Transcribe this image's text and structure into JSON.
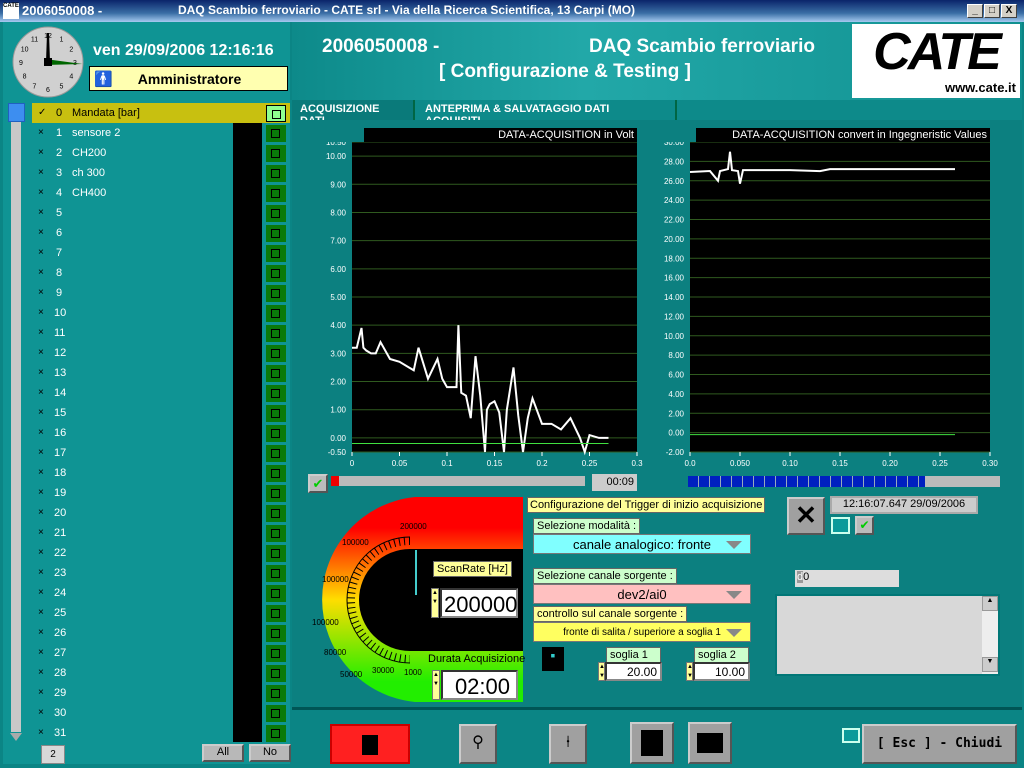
{
  "window": {
    "title_left": "2006050008 -",
    "title_right": "DAQ Scambio ferroviario - CATE srl  -  Via della Ricerca Scientifica, 13 Carpi (MO)",
    "min": "_",
    "max": "□",
    "close": "X"
  },
  "header": {
    "id": "2006050008 -",
    "name": "DAQ Scambio ferroviario",
    "subtitle": "[ Configurazione & Testing ]",
    "logo": "CATE",
    "logo_url": "www.cate.it"
  },
  "clock": {
    "datetime": "ven 29/09/2006 12:16:16",
    "user": "Amministratore",
    "hour_labels": [
      "12",
      "1",
      "2",
      "3",
      "4",
      "5",
      "6",
      "7",
      "8",
      "9",
      "10",
      "11"
    ]
  },
  "channels": [
    {
      "n": "0",
      "label": "Mandata  [bar]",
      "selected": true
    },
    {
      "n": "1",
      "label": "sensore 2"
    },
    {
      "n": "2",
      "label": "CH200"
    },
    {
      "n": "3",
      "label": "ch 300"
    },
    {
      "n": "4",
      "label": "CH400"
    },
    {
      "n": "5",
      "label": ""
    },
    {
      "n": "6",
      "label": ""
    },
    {
      "n": "7",
      "label": ""
    },
    {
      "n": "8",
      "label": ""
    },
    {
      "n": "9",
      "label": ""
    },
    {
      "n": "10",
      "label": ""
    },
    {
      "n": "11",
      "label": ""
    },
    {
      "n": "12",
      "label": ""
    },
    {
      "n": "13",
      "label": ""
    },
    {
      "n": "14",
      "label": ""
    },
    {
      "n": "15",
      "label": ""
    },
    {
      "n": "16",
      "label": ""
    },
    {
      "n": "17",
      "label": ""
    },
    {
      "n": "18",
      "label": ""
    },
    {
      "n": "19",
      "label": ""
    },
    {
      "n": "20",
      "label": ""
    },
    {
      "n": "21",
      "label": ""
    },
    {
      "n": "22",
      "label": ""
    },
    {
      "n": "23",
      "label": ""
    },
    {
      "n": "24",
      "label": ""
    },
    {
      "n": "25",
      "label": ""
    },
    {
      "n": "26",
      "label": ""
    },
    {
      "n": "27",
      "label": ""
    },
    {
      "n": "28",
      "label": ""
    },
    {
      "n": "29",
      "label": ""
    },
    {
      "n": "30",
      "label": ""
    },
    {
      "n": "31",
      "label": ""
    }
  ],
  "channel_list": {
    "index": "2",
    "all": "All",
    "no": "No",
    "checked_mark": "✓",
    "unchecked_mark": "×"
  },
  "tabs": [
    {
      "label": "ACQUISIZIONE DATI",
      "active": true
    },
    {
      "label": "ANTEPRIMA & SALVATAGGIO DATI ACQUISITI"
    }
  ],
  "chart_data": [
    {
      "type": "line",
      "title": "DATA-ACQUISITION in Volt",
      "xlim": [
        0,
        0.3
      ],
      "ylim": [
        -0.5,
        10.5
      ],
      "xticks": [
        "0",
        "0.05",
        "0.1",
        "0.15",
        "0.2",
        "0.25",
        "0.3"
      ],
      "xtick_values": [
        0,
        0.05,
        0.1,
        0.15,
        0.2,
        0.25,
        0.3
      ],
      "yticks": [
        "10.50",
        "10.00",
        "9.00",
        "8.00",
        "7.00",
        "6.00",
        "5.00",
        "4.00",
        "3.00",
        "2.00",
        "1.00",
        "0.00",
        "-0.50"
      ],
      "ytick_values": [
        10.5,
        10,
        9,
        8,
        7,
        6,
        5,
        4,
        3,
        2,
        1,
        0,
        -0.5
      ],
      "grid": true,
      "series": [
        {
          "color": "#ffffff",
          "x": [
            0,
            0.005,
            0.01,
            0.012,
            0.015,
            0.02,
            0.025,
            0.03,
            0.04,
            0.05,
            0.06,
            0.065,
            0.07,
            0.08,
            0.09,
            0.095,
            0.1,
            0.11,
            0.112,
            0.115,
            0.12,
            0.125,
            0.13,
            0.135,
            0.14,
            0.142,
            0.145,
            0.15,
            0.155,
            0.16,
            0.163,
            0.17,
            0.175,
            0.18,
            0.185,
            0.19,
            0.2,
            0.21,
            0.22,
            0.23,
            0.24,
            0.245,
            0.25,
            0.26,
            0.27
          ],
          "y": [
            3.2,
            3.2,
            3.9,
            3.2,
            3.1,
            3.0,
            3.0,
            3.4,
            2.8,
            2.7,
            2.5,
            2.4,
            3.2,
            2.1,
            2.8,
            2.1,
            1.8,
            1.8,
            4.0,
            1.6,
            1.5,
            0.7,
            2.9,
            1.5,
            -0.5,
            1.0,
            1.2,
            1.3,
            0.9,
            -0.5,
            1.0,
            2.5,
            0.8,
            -0.5,
            0.7,
            1.4,
            0.5,
            0.5,
            0.3,
            0.7,
            0.0,
            -0.5,
            0.1,
            0.0,
            0.0
          ]
        },
        {
          "color": "#40e040",
          "x": [
            0,
            0.27
          ],
          "y": [
            -0.2,
            -0.2
          ]
        }
      ]
    },
    {
      "type": "line",
      "title": "DATA-ACQUISITION convert in Ingegneristic Values",
      "xlim": [
        0,
        0.3
      ],
      "ylim": [
        -2,
        30
      ],
      "xticks": [
        "0.0",
        "0.050",
        "0.10",
        "0.15",
        "0.20",
        "0.25",
        "0.30"
      ],
      "xtick_values": [
        0,
        0.05,
        0.1,
        0.15,
        0.2,
        0.25,
        0.3
      ],
      "yticks": [
        "30.00",
        "28.00",
        "26.00",
        "24.00",
        "22.00",
        "20.00",
        "18.00",
        "16.00",
        "14.00",
        "12.00",
        "10.00",
        "8.00",
        "6.00",
        "4.00",
        "2.00",
        "0.00",
        "-2.00"
      ],
      "ytick_values": [
        30,
        28,
        26,
        24,
        22,
        20,
        18,
        16,
        14,
        12,
        10,
        8,
        6,
        4,
        2,
        0,
        -2
      ],
      "grid": true,
      "series": [
        {
          "color": "#ffffff",
          "x": [
            0,
            0.02,
            0.028,
            0.03,
            0.038,
            0.04,
            0.042,
            0.048,
            0.05,
            0.053,
            0.06,
            0.1,
            0.13,
            0.14,
            0.2,
            0.265
          ],
          "y": [
            26.9,
            27.0,
            26.0,
            27.0,
            27.2,
            29.0,
            27.1,
            27.0,
            25.7,
            27.1,
            27.1,
            27.1,
            27.0,
            27.2,
            27.2,
            27.2
          ]
        },
        {
          "color": "#40e040",
          "x": [
            0,
            0.265
          ],
          "y": [
            -0.2,
            -0.2
          ]
        }
      ]
    }
  ],
  "acq": {
    "elapsed": "00:09",
    "progress_left": 0.03,
    "progress_right": 0.76
  },
  "gauge": {
    "labels": [
      "200000",
      "100000",
      "100000",
      "100000",
      "80000",
      "50000",
      "30000",
      "1000"
    ],
    "colors": [
      "#ff0000",
      "#ffcc00",
      "#00ff00"
    ],
    "scanrate_label": "ScanRate [Hz]",
    "scanrate": "200000",
    "duration_label": "Durata Acquisizione",
    "duration": "02:00"
  },
  "trigger": {
    "title": "Configurazione del Trigger di inizio acquisizione",
    "mode_label": "Selezione modalità :",
    "mode": "canale analogico: fronte",
    "source_label": "Selezione canale sorgente :",
    "source": "dev2/ai0",
    "control_label": "controllo sul canale sorgente :",
    "control": "fronte di salita / superiore a soglia 1",
    "s1_label": "soglia 1",
    "s1": "20.00",
    "s2_label": "soglia 2",
    "s2": "10.00"
  },
  "status": {
    "timestamp": "12:16:07.647 29/09/2006",
    "code_prefix": "d",
    "code": "0",
    "log": ""
  },
  "footer": {
    "close": "[ Esc ] - Chiudi"
  }
}
